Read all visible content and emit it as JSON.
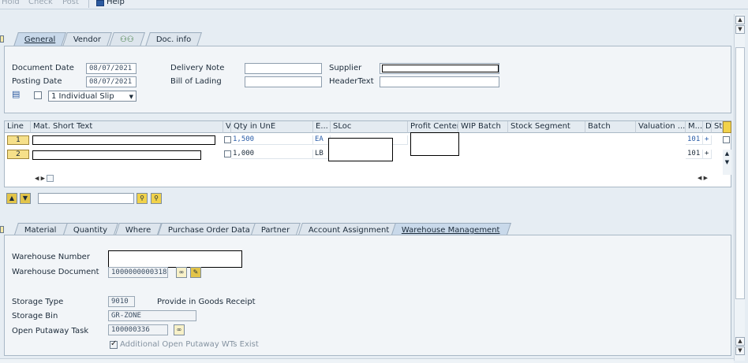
{
  "toolbar": {
    "hold": "Hold",
    "check": "Check",
    "post": "Post",
    "help": "Help"
  },
  "header_tabs": [
    "General",
    "Vendor",
    "",
    "Doc. info"
  ],
  "header": {
    "document_date_label": "Document Date",
    "document_date": "08/07/2021",
    "posting_date_label": "Posting Date",
    "posting_date": "08/07/2021",
    "delivery_note_label": "Delivery Note",
    "delivery_note": "",
    "bill_of_lading_label": "Bill of Lading",
    "bill_of_lading": "",
    "supplier_label": "Supplier",
    "supplier": "",
    "header_text_label": "HeaderText",
    "header_text": "",
    "slip_option": "1 Individual Slip"
  },
  "grid": {
    "columns": [
      "Line",
      "Mat. Short Text",
      "V",
      "Qty in UnE",
      "E...",
      "SLoc",
      "Profit Center",
      "WIP Batch",
      "Stock Segment",
      "Batch",
      "Valuation ...",
      "M...",
      "D",
      "St"
    ],
    "rows": [
      {
        "line": "1",
        "qty": "1,500",
        "unit": "EA",
        "mvt": "101",
        "d": "+"
      },
      {
        "line": "2",
        "qty": "1,000",
        "unit": "LB",
        "mvt": "101",
        "d": "+"
      }
    ]
  },
  "detail_tabs": [
    "Material",
    "Quantity",
    "Where",
    "Purchase Order Data",
    "Partner",
    "Account Assignment",
    "Warehouse Management"
  ],
  "wm": {
    "warehouse_number_label": "Warehouse Number",
    "warehouse_number": "",
    "warehouse_document_label": "Warehouse Document",
    "warehouse_document": "1000000000318",
    "storage_type_label": "Storage Type",
    "storage_type": "9010",
    "storage_type_desc": "Provide in Goods Receipt",
    "storage_bin_label": "Storage Bin",
    "storage_bin": "GR-ZONE",
    "putaway_label": "Open Putaway Task",
    "putaway": "100000336",
    "additional_label": "Additional Open Putaway WTs Exist"
  }
}
